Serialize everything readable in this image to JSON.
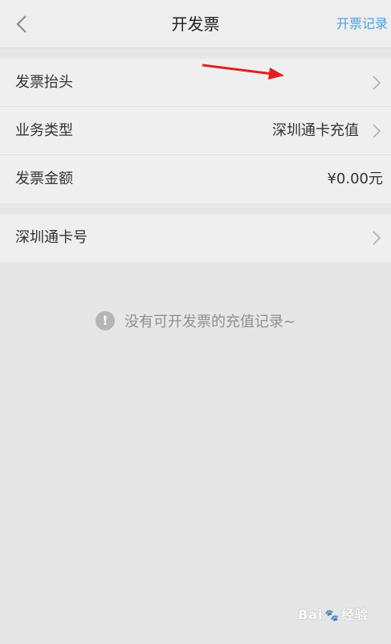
{
  "header": {
    "title": "开发票",
    "right_link": "开票记录",
    "accent_color": "#4aa3e0"
  },
  "form_group_1": {
    "rows": [
      {
        "label": "发票抬头",
        "value": "",
        "chevron": true
      },
      {
        "label": "业务类型",
        "value": "深圳通卡充值",
        "chevron": true
      },
      {
        "label": "发票金额",
        "value": "¥0.00元",
        "chevron": false
      }
    ]
  },
  "form_group_2": {
    "rows": [
      {
        "label": "深圳通卡号",
        "value": "",
        "chevron": true
      }
    ]
  },
  "empty_state": {
    "icon": "info-icon",
    "text": "没有可开发票的充值记录~"
  },
  "watermark": {
    "brand": "Bai",
    "suffix": "经验"
  },
  "annotation_color": "#e02020"
}
